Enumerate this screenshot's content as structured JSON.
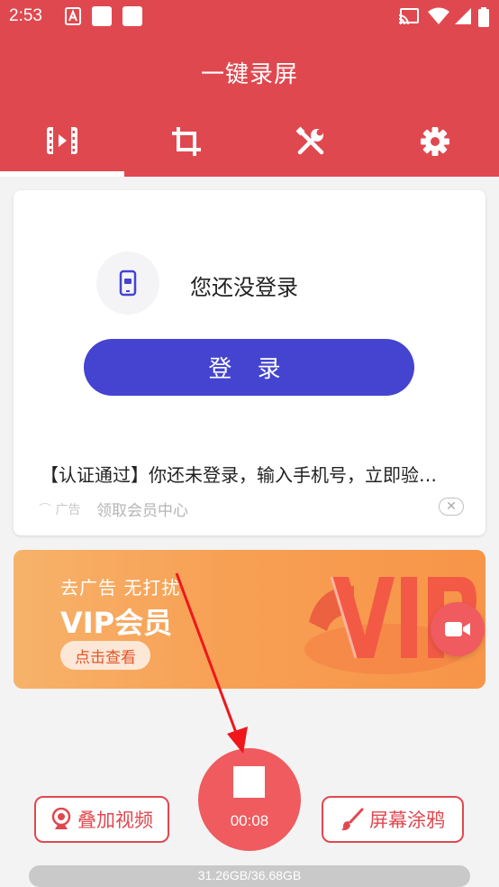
{
  "status_bar": {
    "time": "2:53"
  },
  "app_bar": {
    "title": "一键录屏"
  },
  "tabs": [
    {
      "icon": "film-icon",
      "selected": true
    },
    {
      "icon": "crop-icon",
      "selected": false
    },
    {
      "icon": "tools-icon",
      "selected": false
    },
    {
      "icon": "gear-icon",
      "selected": false
    }
  ],
  "login_card": {
    "title": "您还没登录",
    "login_button": "登 录",
    "notice": "【认证通过】你还未登录，输入手机号，立即验…",
    "ad_tag": "广告",
    "ad_link": "领取会员中心",
    "close_symbol": "✕"
  },
  "vip_banner": {
    "subtitle": "去广告  无打扰",
    "title": "VIP会员",
    "cta": "点击查看"
  },
  "controls": {
    "overlay_video": "叠加视频",
    "screen_doodle": "屏幕涂鸦",
    "timer": "00:08"
  },
  "storage": {
    "label": "31.26GB/36.68GB"
  },
  "colors": {
    "primary": "#e0484f",
    "login_button": "#4444d1",
    "record": "#ef5b5e",
    "annotation_arrow": "#f0161c"
  }
}
